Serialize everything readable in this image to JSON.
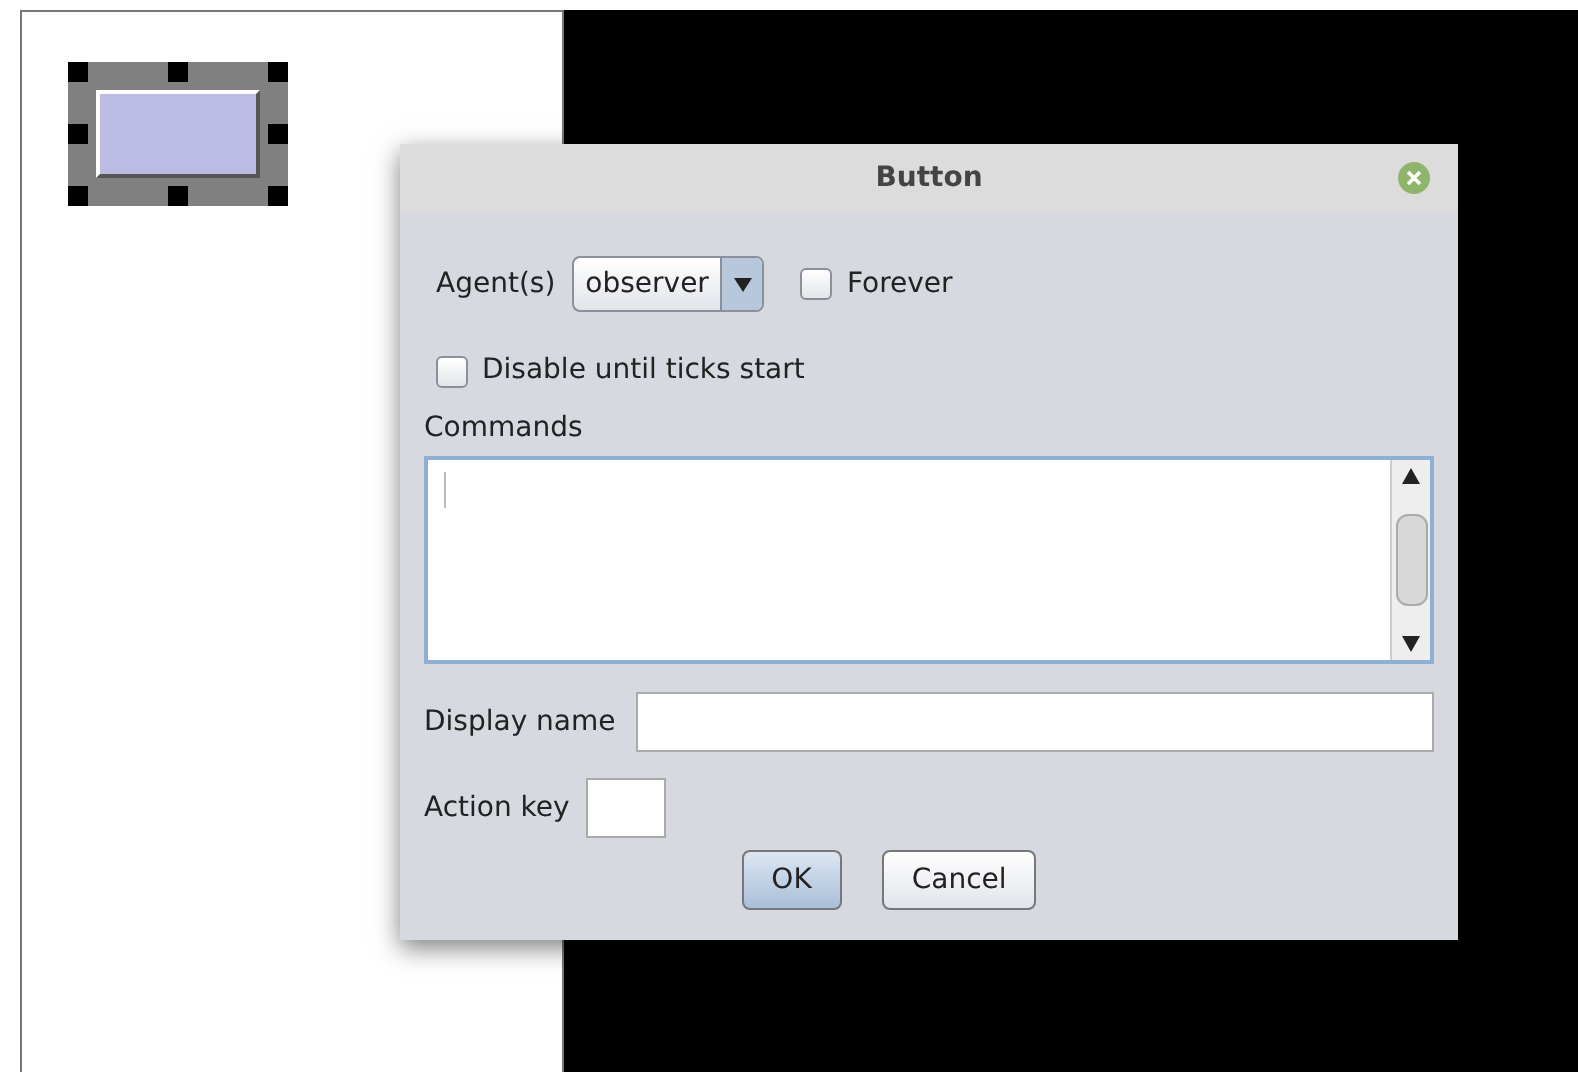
{
  "canvas_widget": {
    "selected": true
  },
  "dialog": {
    "title": "Button",
    "agents": {
      "label": "Agent(s)",
      "value": "observer"
    },
    "forever": {
      "label": "Forever",
      "checked": false
    },
    "disable_until_ticks": {
      "label": "Disable until ticks start",
      "checked": false
    },
    "commands": {
      "label": "Commands"
    },
    "display_name": {
      "label": "Display name"
    },
    "action_key": {
      "label": "Action key"
    },
    "buttons": [
      {
        "label": "OK",
        "default": true
      },
      {
        "label": "Cancel",
        "default": false
      }
    ]
  }
}
